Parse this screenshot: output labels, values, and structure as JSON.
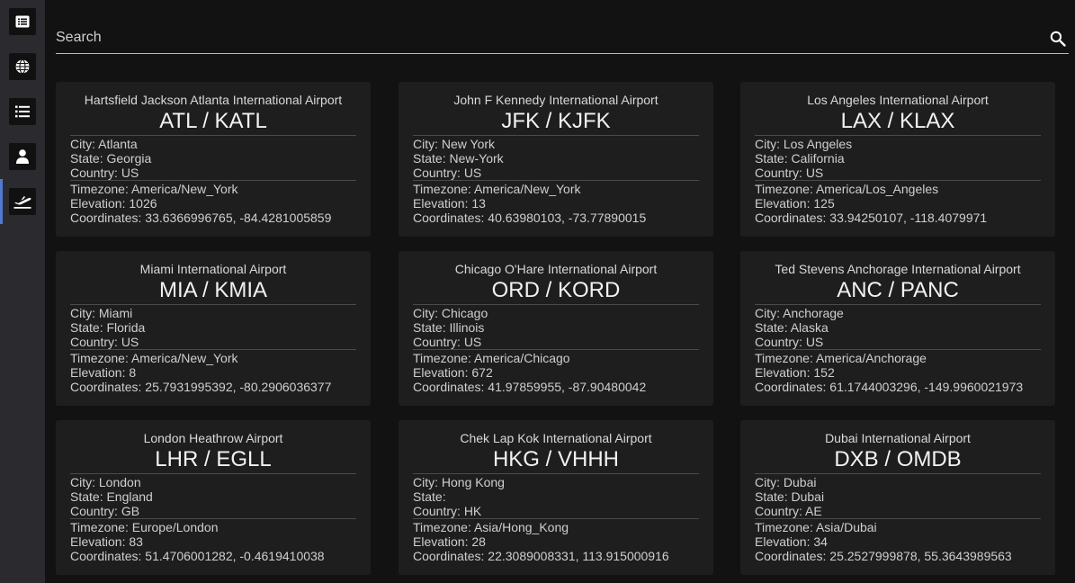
{
  "nav": {
    "items": [
      {
        "name": "list-alt-icon",
        "active": false
      },
      {
        "name": "globe-icon",
        "active": false
      },
      {
        "name": "bulleted-list-icon",
        "active": false
      },
      {
        "name": "user-icon",
        "active": false
      },
      {
        "name": "plane-departure-icon",
        "active": true
      }
    ],
    "accent_color": "#4e7ad0"
  },
  "search": {
    "placeholder": "Search",
    "value": "",
    "icon": "search-icon"
  },
  "labels": {
    "city": "City: ",
    "state": "State: ",
    "country": "Country: ",
    "timezone": "Timezone: ",
    "elevation": "Elevation: ",
    "coordinates": "Coordinates: ",
    "code_separator": " / "
  },
  "airports": [
    {
      "name": "Hartsfield Jackson Atlanta International Airport",
      "iata": "ATL",
      "icao": "KATL",
      "city": "Atlanta",
      "state": "Georgia",
      "country": "US",
      "timezone": "America/New_York",
      "elevation": "1026",
      "coordinates": "33.6366996765, -84.4281005859"
    },
    {
      "name": "John F Kennedy International Airport",
      "iata": "JFK",
      "icao": "KJFK",
      "city": "New York",
      "state": "New-York",
      "country": "US",
      "timezone": "America/New_York",
      "elevation": "13",
      "coordinates": "40.63980103, -73.77890015"
    },
    {
      "name": "Los Angeles International Airport",
      "iata": "LAX",
      "icao": "KLAX",
      "city": "Los Angeles",
      "state": "California",
      "country": "US",
      "timezone": "America/Los_Angeles",
      "elevation": "125",
      "coordinates": "33.94250107, -118.4079971"
    },
    {
      "name": "Miami International Airport",
      "iata": "MIA",
      "icao": "KMIA",
      "city": "Miami",
      "state": "Florida",
      "country": "US",
      "timezone": "America/New_York",
      "elevation": "8",
      "coordinates": "25.7931995392, -80.2906036377"
    },
    {
      "name": "Chicago O'Hare International Airport",
      "iata": "ORD",
      "icao": "KORD",
      "city": "Chicago",
      "state": "Illinois",
      "country": "US",
      "timezone": "America/Chicago",
      "elevation": "672",
      "coordinates": "41.97859955, -87.90480042"
    },
    {
      "name": "Ted Stevens Anchorage International Airport",
      "iata": "ANC",
      "icao": "PANC",
      "city": "Anchorage",
      "state": "Alaska",
      "country": "US",
      "timezone": "America/Anchorage",
      "elevation": "152",
      "coordinates": "61.1744003296, -149.9960021973"
    },
    {
      "name": "London Heathrow Airport",
      "iata": "LHR",
      "icao": "EGLL",
      "city": "London",
      "state": "England",
      "country": "GB",
      "timezone": "Europe/London",
      "elevation": "83",
      "coordinates": "51.4706001282, -0.4619410038"
    },
    {
      "name": "Chek Lap Kok International Airport",
      "iata": "HKG",
      "icao": "VHHH",
      "city": "Hong Kong",
      "state": "",
      "country": "HK",
      "timezone": "Asia/Hong_Kong",
      "elevation": "28",
      "coordinates": "22.3089008331, 113.915000916"
    },
    {
      "name": "Dubai International Airport",
      "iata": "DXB",
      "icao": "OMDB",
      "city": "Dubai",
      "state": "Dubai",
      "country": "AE",
      "timezone": "Asia/Dubai",
      "elevation": "34",
      "coordinates": "25.2527999878, 55.3643989563"
    }
  ]
}
